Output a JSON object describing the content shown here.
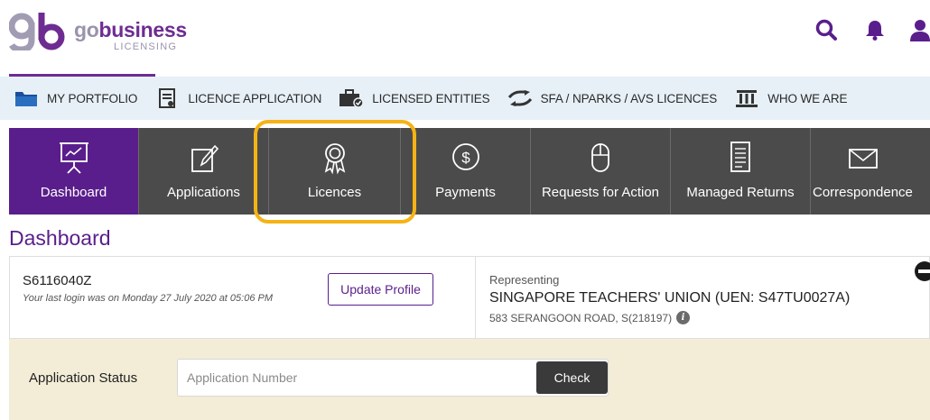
{
  "brand": {
    "prefix": "go",
    "name": "business",
    "subtitle": "LICENSING",
    "primary_color": "#5a1e8c",
    "logo_icon": "gb-logo"
  },
  "header_icons": [
    "search-icon",
    "bell-icon",
    "user-icon"
  ],
  "topnav": [
    {
      "icon": "folder-icon",
      "label": "MY PORTFOLIO"
    },
    {
      "icon": "document-icon",
      "label": "LICENCE APPLICATION"
    },
    {
      "icon": "briefcase-icon",
      "label": "LICENSED ENTITIES"
    },
    {
      "icon": "exchange-icon",
      "label": "SFA / NPARKS / AVS LICENCES"
    },
    {
      "icon": "government-building-icon",
      "label": "WHO WE ARE"
    }
  ],
  "tabs": [
    {
      "icon": "presentation-icon",
      "label": "Dashboard",
      "active": true
    },
    {
      "icon": "edit-icon",
      "label": "Applications",
      "active": false
    },
    {
      "icon": "award-ribbon-icon",
      "label": "Licences",
      "active": false,
      "highlighted": true
    },
    {
      "icon": "dollar-icon",
      "label": "Payments",
      "active": false
    },
    {
      "icon": "mouse-icon",
      "label": "Requests for Action",
      "active": false
    },
    {
      "icon": "document-lines-icon",
      "label": "Managed Returns",
      "active": false
    },
    {
      "icon": "envelope-icon",
      "label": "Correspondence",
      "active": false
    }
  ],
  "highlight_color": "#f5b316",
  "dashboard": {
    "title": "Dashboard",
    "user_id": "S6116040Z",
    "last_login": "Your last login was on Monday 27 July 2020 at 05:06 PM",
    "update_profile_label": "Update Profile",
    "representing_label": "Representing",
    "entity": "SINGAPORE TEACHERS' UNION (UEN: S47TU0027A)",
    "address": "583 SERANGOON ROAD, S(218197)"
  },
  "application_status": {
    "label": "Application Status",
    "placeholder": "Application Number",
    "value": "",
    "check_label": "Check"
  }
}
